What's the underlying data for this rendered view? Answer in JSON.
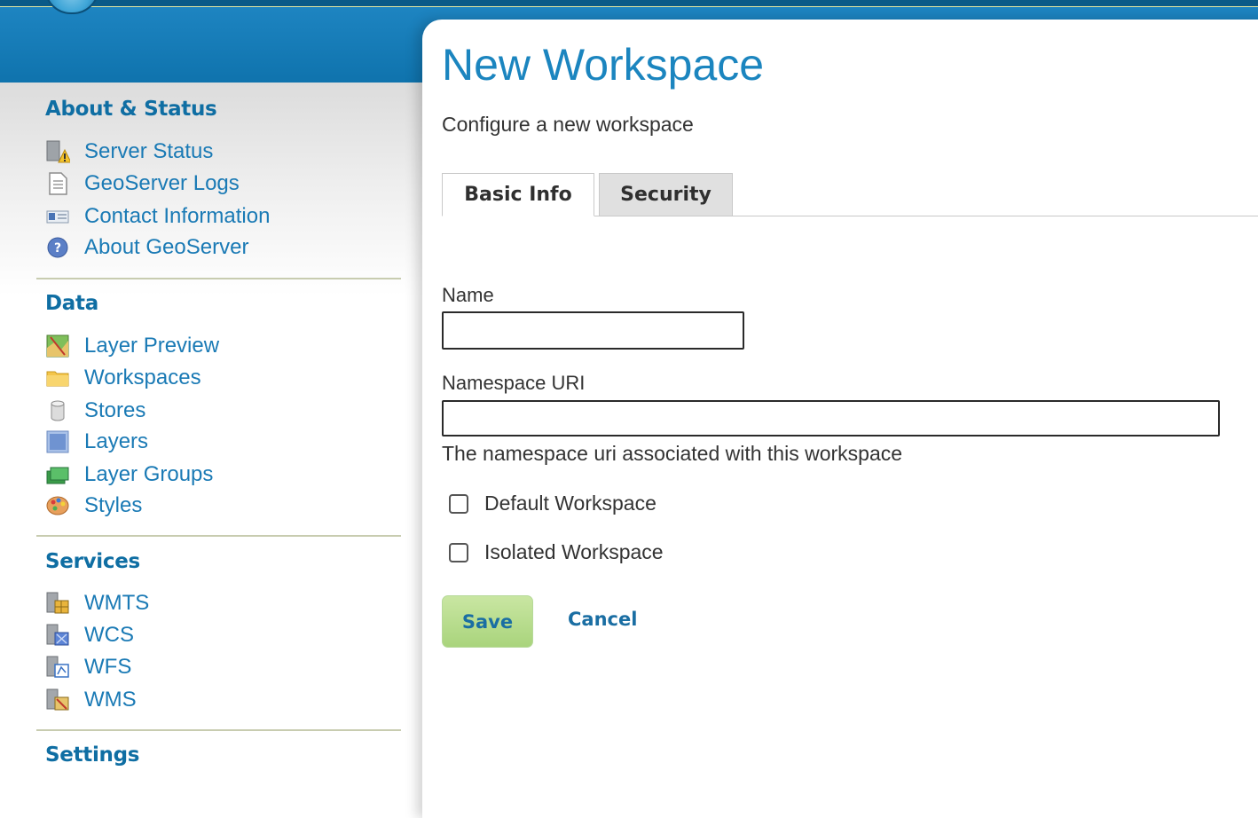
{
  "colors": {
    "header": "#1679b5",
    "link": "#1a7ab5",
    "heading": "#0f6ea3",
    "save_button": "#b8dc8f"
  },
  "sidebar": {
    "sections": [
      {
        "heading": "About & Status",
        "items": [
          {
            "label": "Server Status",
            "icon": "server-status-icon"
          },
          {
            "label": "GeoServer Logs",
            "icon": "document-icon"
          },
          {
            "label": "Contact Information",
            "icon": "contact-card-icon"
          },
          {
            "label": "About GeoServer",
            "icon": "help-circle-icon"
          }
        ]
      },
      {
        "heading": "Data",
        "items": [
          {
            "label": "Layer Preview",
            "icon": "map-preview-icon"
          },
          {
            "label": "Workspaces",
            "icon": "folder-icon"
          },
          {
            "label": "Stores",
            "icon": "database-icon"
          },
          {
            "label": "Layers",
            "icon": "layer-icon"
          },
          {
            "label": "Layer Groups",
            "icon": "layer-group-icon"
          },
          {
            "label": "Styles",
            "icon": "palette-icon"
          }
        ]
      },
      {
        "heading": "Services",
        "items": [
          {
            "label": "WMTS",
            "icon": "wmts-service-icon"
          },
          {
            "label": "WCS",
            "icon": "wcs-service-icon"
          },
          {
            "label": "WFS",
            "icon": "wfs-service-icon"
          },
          {
            "label": "WMS",
            "icon": "wms-service-icon"
          }
        ]
      },
      {
        "heading": "Settings",
        "items": []
      }
    ]
  },
  "main": {
    "title": "New Workspace",
    "description": "Configure a new workspace",
    "tabs": [
      {
        "label": "Basic Info",
        "active": true
      },
      {
        "label": "Security",
        "active": false
      }
    ],
    "form": {
      "name_label": "Name",
      "name_value": "",
      "namespace_label": "Namespace URI",
      "namespace_value": "",
      "namespace_hint": "The namespace uri associated with this workspace",
      "default_workspace_label": "Default Workspace",
      "default_workspace_checked": false,
      "isolated_workspace_label": "Isolated Workspace",
      "isolated_workspace_checked": false
    },
    "save_label": "Save",
    "cancel_label": "Cancel"
  }
}
